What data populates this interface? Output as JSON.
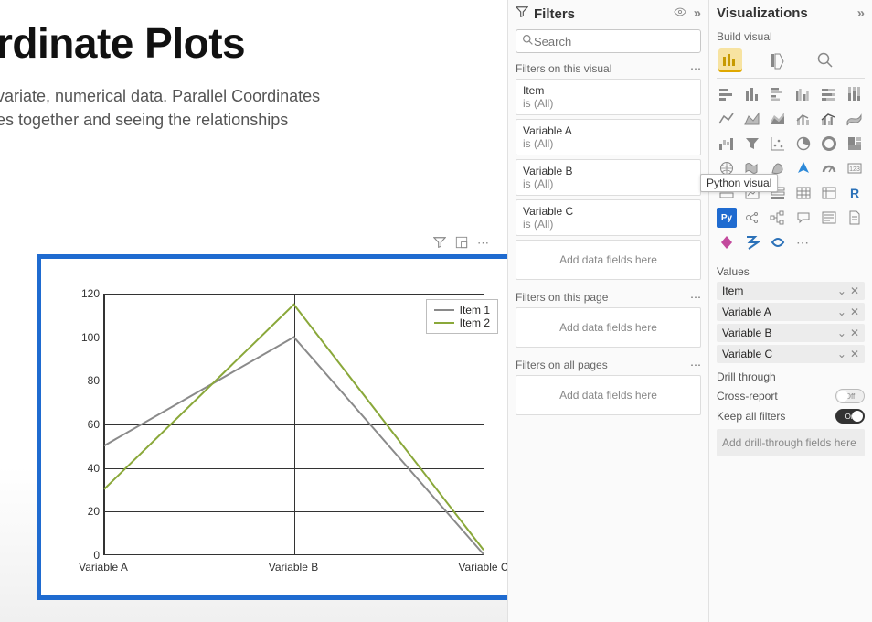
{
  "chart_data": {
    "type": "line",
    "categories": [
      "Variable A",
      "Variable B",
      "Variable C"
    ],
    "series": [
      {
        "name": "Item 1",
        "values": [
          50,
          100,
          0
        ],
        "color": "#8a8a8a"
      },
      {
        "name": "Item 2",
        "values": [
          30,
          115,
          2
        ],
        "color": "#8aa83a"
      }
    ],
    "ylim": [
      0,
      120
    ],
    "yticks": [
      0,
      20,
      40,
      60,
      80,
      100,
      120
    ],
    "xlabel": "",
    "ylabel": "",
    "title": "",
    "grid": true
  },
  "canvas": {
    "title": "rdinate Plots",
    "subtitle_line1": "variate, numerical data. Parallel Coordinates",
    "subtitle_line2": "es together and seeing the relationships"
  },
  "filters": {
    "header": "Filters",
    "search_placeholder": "Search",
    "section_visual": "Filters on this visual",
    "section_page": "Filters on this page",
    "section_all": "Filters on all pages",
    "add_fields": "Add data fields here",
    "items": [
      {
        "name": "Item",
        "value": "is (All)"
      },
      {
        "name": "Variable A",
        "value": "is (All)"
      },
      {
        "name": "Variable B",
        "value": "is (All)"
      },
      {
        "name": "Variable C",
        "value": "is (All)"
      }
    ]
  },
  "viz": {
    "header": "Visualizations",
    "sub": "Build visual",
    "tooltip": "Python visual",
    "values_label": "Values",
    "fields": [
      "Item",
      "Variable A",
      "Variable B",
      "Variable C"
    ],
    "drill_header": "Drill through",
    "cross_report": "Cross-report",
    "cross_report_state": "Off",
    "keep_filters": "Keep all filters",
    "keep_filters_state": "On",
    "drill_drop": "Add drill-through fields here",
    "r_label": "R",
    "py_label": "Py"
  }
}
